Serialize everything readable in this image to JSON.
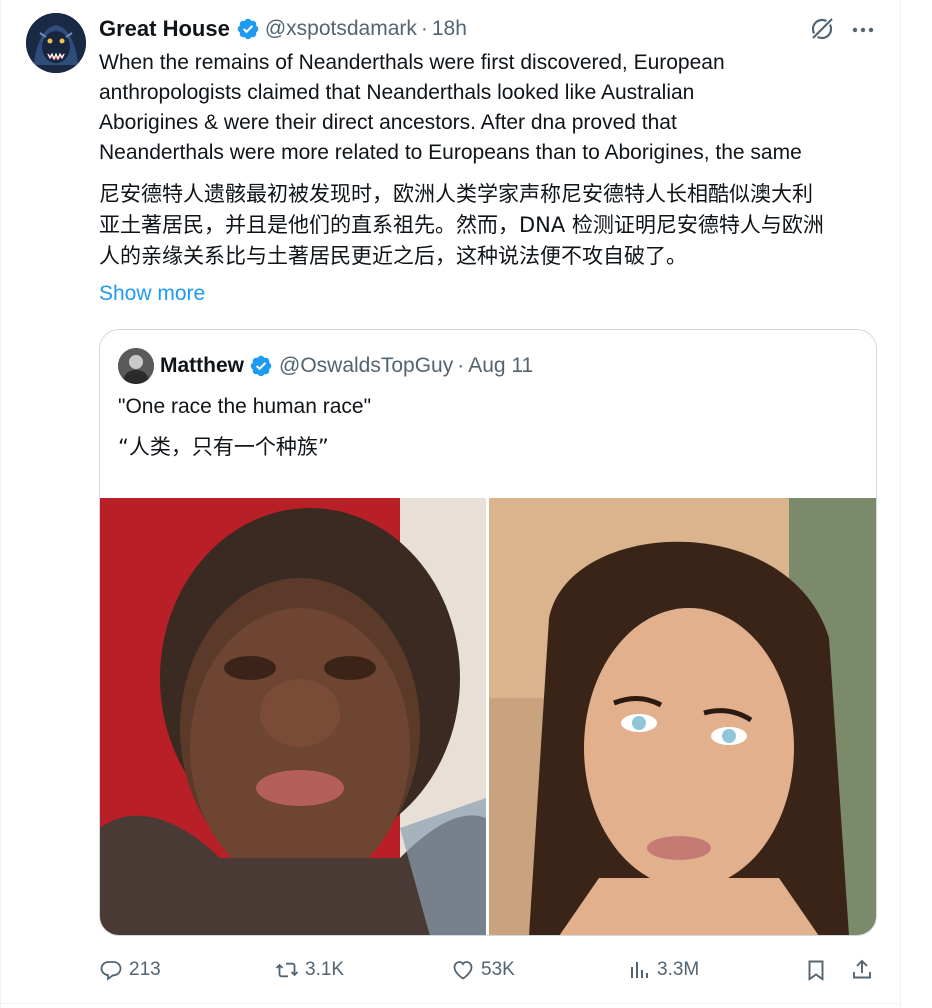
{
  "tweet": {
    "author": {
      "display_name": "Great House",
      "handle": "@xspotsdamark",
      "time": "18h"
    },
    "text_lines": [
      "When the remains of Neanderthals were first discovered, European",
      "anthropologists claimed that Neanderthals looked like Australian",
      "Aborigines & were their direct ancestors. After dna proved that",
      "Neanderthals were more related to Europeans than to Aborigines, the same"
    ],
    "translation_lines": [
      "尼安德特人遗骸最初被发现时，欧洲人类学家声称尼安德特人长相酷似澳大利",
      "亚土著居民，并且是他们的直系祖先。然而，DNA 检测证明尼安德特人与欧洲",
      "人的亲缘关系比与土著居民更近之后，这种说法便不攻自破了。"
    ],
    "show_more_label": "Show more"
  },
  "quote": {
    "author": {
      "display_name": "Matthew",
      "handle": "@OswaldsTopGuy",
      "time": "Aug 11"
    },
    "text": "\"One race the human race\"",
    "translation": "“人类，只有一个种族”"
  },
  "actions": {
    "replies": "213",
    "reposts": "3.1K",
    "likes": "53K",
    "views": "3.3M"
  },
  "icons": {
    "verified": "verified-badge-icon",
    "grok": "grok-icon",
    "more": "more-icon",
    "reply": "reply-icon",
    "repost": "repost-icon",
    "like": "heart-icon",
    "views": "views-icon",
    "bookmark": "bookmark-icon",
    "share": "share-icon"
  },
  "colors": {
    "accent": "#1d9bf0",
    "secondary_text": "#536471",
    "border": "#cfd9de"
  }
}
